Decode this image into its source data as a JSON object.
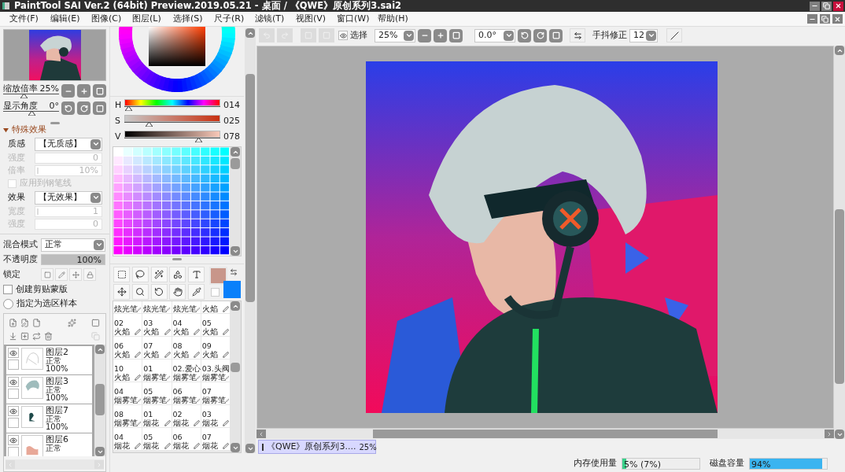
{
  "window": {
    "title": "PaintTool SAI Ver.2 (64bit) Preview.2019.05.21 - 桌面 / 《QWE》原创系列3.sai2"
  },
  "menu": [
    "文件(F)",
    "编辑(E)",
    "图像(C)",
    "图层(L)",
    "选择(S)",
    "尺子(R)",
    "滤镜(T)",
    "视图(V)",
    "窗口(W)",
    "帮助(H)"
  ],
  "navigator": {
    "zoom": {
      "label": "缩放倍率",
      "value": "25%",
      "level": 0.36
    },
    "angle": {
      "label": "显示角度",
      "value": "0°",
      "level": 0.5
    }
  },
  "effects": {
    "title": "特殊效果",
    "expanded": true,
    "rows": [
      {
        "kind": "select",
        "label": "质感",
        "value": "【无质感】",
        "disabled": false
      },
      {
        "kind": "number",
        "label": "强度",
        "value": "0",
        "disabled": true
      },
      {
        "kind": "slider",
        "label": "倍率",
        "value": "10%",
        "disabled": true
      },
      {
        "kind": "checkbox",
        "label": "应用到钢笔线",
        "checked": false,
        "disabled": true
      },
      {
        "kind": "select",
        "label": "效果",
        "value": "【无效果】",
        "disabled": false
      },
      {
        "kind": "slider",
        "label": "宽度",
        "value": "1",
        "disabled": true
      },
      {
        "kind": "number",
        "label": "强度",
        "value": "0",
        "disabled": true
      }
    ]
  },
  "blending": {
    "mode": {
      "label": "混合模式",
      "value": "正常"
    },
    "opacity": {
      "label": "不透明度",
      "value": "100%",
      "level": 1
    },
    "lock_label": "锁定",
    "clipping": {
      "label": "创建剪贴蒙版",
      "checked": false
    },
    "selection_source": {
      "label": "指定为选区样本",
      "checked": false
    }
  },
  "layers": [
    {
      "name": "图层2",
      "mode": "正常",
      "opacity": "100%",
      "visible": true,
      "checked": false
    },
    {
      "name": "图层3",
      "mode": "正常",
      "opacity": "100%",
      "visible": true,
      "checked": false
    },
    {
      "name": "图层7",
      "mode": "正常",
      "opacity": "100%",
      "visible": true,
      "checked": false
    },
    {
      "name": "图层6",
      "mode": "正常",
      "visible": true,
      "checked": false
    }
  ],
  "color": {
    "sliders": [
      {
        "label": "H",
        "value": "014",
        "level": 0.04
      },
      {
        "label": "S",
        "value": "025",
        "level": 0.25
      },
      {
        "label": "V",
        "value": "078",
        "level": 0.77
      }
    ],
    "swatches": [
      {
        "kind": "main",
        "color": "#c8968a"
      },
      {
        "kind": "sub",
        "color": "#0a80fa"
      }
    ]
  },
  "brushes": [
    {
      "name": "炫光笔"
    },
    {
      "name": "炫光笔"
    },
    {
      "name": "炫光笔"
    },
    {
      "name": "火焰"
    },
    {
      "number": "02",
      "name": "火焰"
    },
    {
      "number": "03",
      "name": "火焰"
    },
    {
      "number": "04",
      "name": "火焰"
    },
    {
      "number": "05",
      "name": "火焰"
    },
    {
      "number": "06",
      "name": "火焰"
    },
    {
      "number": "07",
      "name": "火焰"
    },
    {
      "number": "08",
      "name": "火焰"
    },
    {
      "number": "09",
      "name": "火焰"
    },
    {
      "number": "10",
      "name": "火焰"
    },
    {
      "number": "01",
      "name": "烟雾笔"
    },
    {
      "number": "02.爱心",
      "name": "烟雾笔"
    },
    {
      "number": "03.头阀",
      "name": "烟雾笔"
    },
    {
      "number": "04",
      "name": "烟雾笔"
    },
    {
      "number": "05",
      "name": "烟雾笔"
    },
    {
      "number": "06",
      "name": "烟雾笔"
    },
    {
      "number": "07",
      "name": "烟雾笔"
    },
    {
      "number": "08",
      "name": "烟雾笔"
    },
    {
      "number": "01",
      "name": "烟花"
    },
    {
      "number": "02",
      "name": "烟花"
    },
    {
      "number": "03",
      "name": "烟花"
    },
    {
      "number": "04",
      "name": "烟花"
    },
    {
      "number": "05",
      "name": "烟花"
    },
    {
      "number": "06",
      "name": "烟花"
    },
    {
      "number": "07",
      "name": "烟花"
    }
  ],
  "toolbar": {
    "select_label": "选择",
    "zoom": "25%",
    "angle": "0.0°",
    "stabilizer_label": "手抖修正",
    "stabilizer": "12"
  },
  "documents": [
    {
      "title": "《QWE》原创系列3....",
      "zoom": "25%",
      "selected": true
    }
  ],
  "status": [
    {
      "label": "内存使用量",
      "value": "5% (7%)",
      "level": 0.05
    },
    {
      "label": "磁盘容量",
      "value": "94%",
      "level": 0.94
    }
  ]
}
